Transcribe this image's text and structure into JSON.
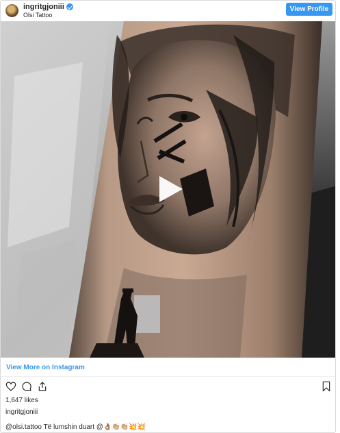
{
  "header": {
    "username": "ingritgjoniii",
    "location": "Olsi Tattoo",
    "view_profile_label": "View Profile",
    "verified": true
  },
  "media": {
    "type": "video",
    "subject": "forearm tattoo of a woman's face with roman numerals and a silhouetted figure",
    "play_icon": "play-icon"
  },
  "view_more_label": "View More on Instagram",
  "actions": {
    "icons": [
      "heart-icon",
      "comment-icon",
      "share-icon",
      "bookmark-icon"
    ]
  },
  "likes_text": "1,647 likes",
  "owner_username": "ingritgjoniii",
  "caption": {
    "mention": "@olsi.tattoo",
    "text": " Të lumshin duart @👌🏽👏🏼👏🏼💥💥"
  },
  "colors": {
    "accent": "#3897f0",
    "text": "#262626",
    "border": "#dbdbdb"
  }
}
